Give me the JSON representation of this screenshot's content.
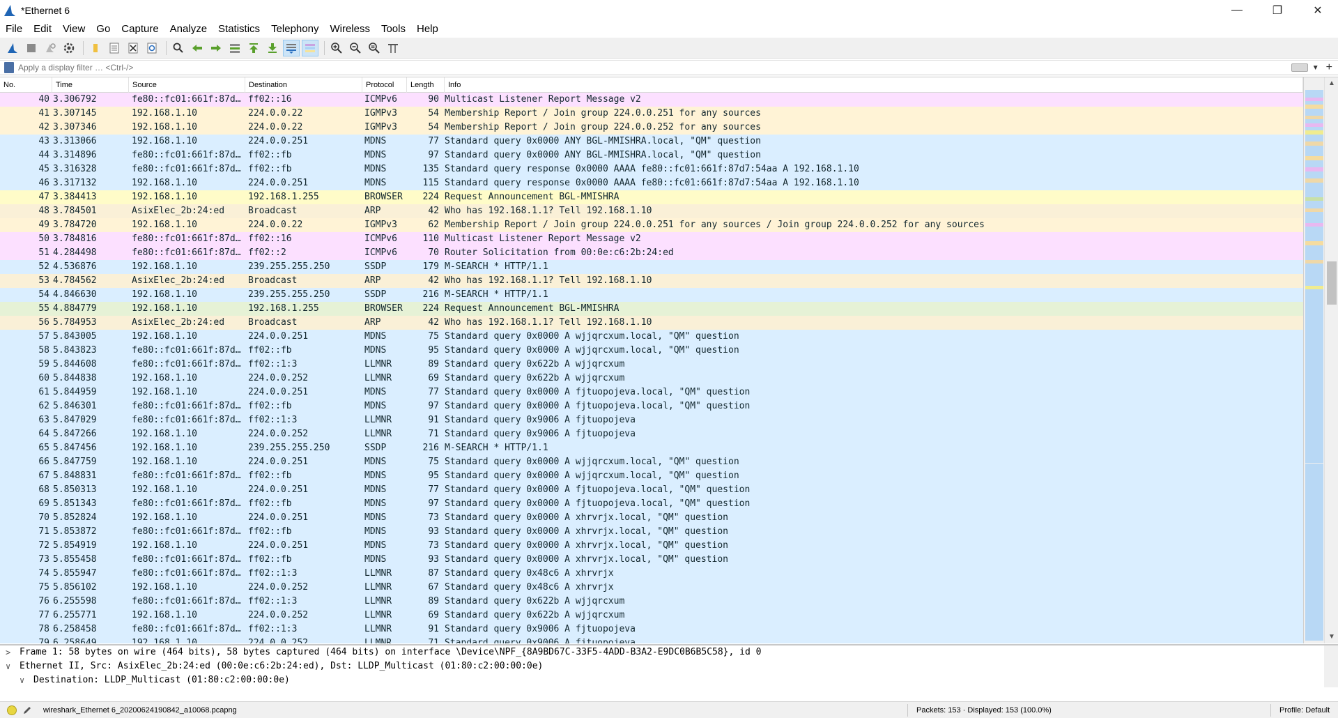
{
  "window": {
    "title": "*Ethernet 6",
    "minimize_glyph": "—",
    "maximize_glyph": "❐",
    "close_glyph": "✕"
  },
  "menu": [
    "File",
    "Edit",
    "View",
    "Go",
    "Capture",
    "Analyze",
    "Statistics",
    "Telephony",
    "Wireless",
    "Tools",
    "Help"
  ],
  "toolbar": {
    "icons": [
      "shark-fin-start-icon",
      "stop-icon",
      "restart-icon",
      "options-gear-icon",
      "open-folder-icon",
      "save-file-icon",
      "close-file-icon",
      "reload-icon",
      "find-icon",
      "go-back-icon",
      "go-forward-icon",
      "go-to-packet-icon",
      "first-packet-icon",
      "last-packet-icon",
      "autoscroll-icon",
      "colorize-icon",
      "zoom-in-icon",
      "zoom-out-icon",
      "normal-size-icon",
      "resize-columns-icon"
    ]
  },
  "filter": {
    "placeholder": "Apply a display filter … <Ctrl-/>"
  },
  "columns": [
    "No.",
    "Time",
    "Source",
    "Destination",
    "Protocol",
    "Length",
    "Info"
  ],
  "packets": [
    {
      "no": "40",
      "time": "3.306792",
      "src": "fe80::fc01:661f:87d…",
      "dst": "ff02::16",
      "proto": "ICMPv6",
      "len": "90",
      "info": "Multicast Listener Report Message v2",
      "cls": "icmp"
    },
    {
      "no": "41",
      "time": "3.307145",
      "src": "192.168.1.10",
      "dst": "224.0.0.22",
      "proto": "IGMPv3",
      "len": "54",
      "info": "Membership Report / Join group 224.0.0.251 for any sources",
      "cls": "igmp"
    },
    {
      "no": "42",
      "time": "3.307346",
      "src": "192.168.1.10",
      "dst": "224.0.0.22",
      "proto": "IGMPv3",
      "len": "54",
      "info": "Membership Report / Join group 224.0.0.252 for any sources",
      "cls": "igmp"
    },
    {
      "no": "43",
      "time": "3.313066",
      "src": "192.168.1.10",
      "dst": "224.0.0.251",
      "proto": "MDNS",
      "len": "77",
      "info": "Standard query 0x0000 ANY BGL-MMISHRA.local, \"QM\" question",
      "cls": "udp"
    },
    {
      "no": "44",
      "time": "3.314896",
      "src": "fe80::fc01:661f:87d…",
      "dst": "ff02::fb",
      "proto": "MDNS",
      "len": "97",
      "info": "Standard query 0x0000 ANY BGL-MMISHRA.local, \"QM\" question",
      "cls": "udp"
    },
    {
      "no": "45",
      "time": "3.316328",
      "src": "fe80::fc01:661f:87d…",
      "dst": "ff02::fb",
      "proto": "MDNS",
      "len": "135",
      "info": "Standard query response 0x0000 AAAA fe80::fc01:661f:87d7:54aa A 192.168.1.10",
      "cls": "udp"
    },
    {
      "no": "46",
      "time": "3.317132",
      "src": "192.168.1.10",
      "dst": "224.0.0.251",
      "proto": "MDNS",
      "len": "115",
      "info": "Standard query response 0x0000 AAAA fe80::fc01:661f:87d7:54aa A 192.168.1.10",
      "cls": "udp"
    },
    {
      "no": "47",
      "time": "3.384413",
      "src": "192.168.1.10",
      "dst": "192.168.1.255",
      "proto": "BROWSER",
      "len": "224",
      "info": "Request Announcement BGL-MMISHRA",
      "cls": "browser"
    },
    {
      "no": "48",
      "time": "3.784501",
      "src": "AsixElec_2b:24:ed",
      "dst": "Broadcast",
      "proto": "ARP",
      "len": "42",
      "info": "Who has 192.168.1.1? Tell 192.168.1.10",
      "cls": "arp"
    },
    {
      "no": "49",
      "time": "3.784720",
      "src": "192.168.1.10",
      "dst": "224.0.0.22",
      "proto": "IGMPv3",
      "len": "62",
      "info": "Membership Report / Join group 224.0.0.251 for any sources / Join group 224.0.0.252 for any sources",
      "cls": "igmp"
    },
    {
      "no": "50",
      "time": "3.784816",
      "src": "fe80::fc01:661f:87d…",
      "dst": "ff02::16",
      "proto": "ICMPv6",
      "len": "110",
      "info": "Multicast Listener Report Message v2",
      "cls": "icmp"
    },
    {
      "no": "51",
      "time": "4.284498",
      "src": "fe80::fc01:661f:87d…",
      "dst": "ff02::2",
      "proto": "ICMPv6",
      "len": "70",
      "info": "Router Solicitation from 00:0e:c6:2b:24:ed",
      "cls": "icmp"
    },
    {
      "no": "52",
      "time": "4.536876",
      "src": "192.168.1.10",
      "dst": "239.255.255.250",
      "proto": "SSDP",
      "len": "179",
      "info": "M-SEARCH * HTTP/1.1",
      "cls": "udp"
    },
    {
      "no": "53",
      "time": "4.784562",
      "src": "AsixElec_2b:24:ed",
      "dst": "Broadcast",
      "proto": "ARP",
      "len": "42",
      "info": "Who has 192.168.1.1? Tell 192.168.1.10",
      "cls": "arp"
    },
    {
      "no": "54",
      "time": "4.846630",
      "src": "192.168.1.10",
      "dst": "239.255.255.250",
      "proto": "SSDP",
      "len": "216",
      "info": "M-SEARCH * HTTP/1.1",
      "cls": "udp"
    },
    {
      "no": "55",
      "time": "4.884779",
      "src": "192.168.1.10",
      "dst": "192.168.1.255",
      "proto": "BROWSER",
      "len": "224",
      "info": "Request Announcement BGL-MMISHRA",
      "cls": "browser2"
    },
    {
      "no": "56",
      "time": "5.784953",
      "src": "AsixElec_2b:24:ed",
      "dst": "Broadcast",
      "proto": "ARP",
      "len": "42",
      "info": "Who has 192.168.1.1? Tell 192.168.1.10",
      "cls": "arp"
    },
    {
      "no": "57",
      "time": "5.843005",
      "src": "192.168.1.10",
      "dst": "224.0.0.251",
      "proto": "MDNS",
      "len": "75",
      "info": "Standard query 0x0000 A wjjqrcxum.local, \"QM\" question",
      "cls": "udp"
    },
    {
      "no": "58",
      "time": "5.843823",
      "src": "fe80::fc01:661f:87d…",
      "dst": "ff02::fb",
      "proto": "MDNS",
      "len": "95",
      "info": "Standard query 0x0000 A wjjqrcxum.local, \"QM\" question",
      "cls": "udp"
    },
    {
      "no": "59",
      "time": "5.844608",
      "src": "fe80::fc01:661f:87d…",
      "dst": "ff02::1:3",
      "proto": "LLMNR",
      "len": "89",
      "info": "Standard query 0x622b A wjjqrcxum",
      "cls": "udp"
    },
    {
      "no": "60",
      "time": "5.844838",
      "src": "192.168.1.10",
      "dst": "224.0.0.252",
      "proto": "LLMNR",
      "len": "69",
      "info": "Standard query 0x622b A wjjqrcxum",
      "cls": "udp"
    },
    {
      "no": "61",
      "time": "5.844959",
      "src": "192.168.1.10",
      "dst": "224.0.0.251",
      "proto": "MDNS",
      "len": "77",
      "info": "Standard query 0x0000 A fjtuopojeva.local, \"QM\" question",
      "cls": "udp"
    },
    {
      "no": "62",
      "time": "5.846301",
      "src": "fe80::fc01:661f:87d…",
      "dst": "ff02::fb",
      "proto": "MDNS",
      "len": "97",
      "info": "Standard query 0x0000 A fjtuopojeva.local, \"QM\" question",
      "cls": "udp"
    },
    {
      "no": "63",
      "time": "5.847029",
      "src": "fe80::fc01:661f:87d…",
      "dst": "ff02::1:3",
      "proto": "LLMNR",
      "len": "91",
      "info": "Standard query 0x9006 A fjtuopojeva",
      "cls": "udp"
    },
    {
      "no": "64",
      "time": "5.847266",
      "src": "192.168.1.10",
      "dst": "224.0.0.252",
      "proto": "LLMNR",
      "len": "71",
      "info": "Standard query 0x9006 A fjtuopojeva",
      "cls": "udp"
    },
    {
      "no": "65",
      "time": "5.847456",
      "src": "192.168.1.10",
      "dst": "239.255.255.250",
      "proto": "SSDP",
      "len": "216",
      "info": "M-SEARCH * HTTP/1.1",
      "cls": "udp"
    },
    {
      "no": "66",
      "time": "5.847759",
      "src": "192.168.1.10",
      "dst": "224.0.0.251",
      "proto": "MDNS",
      "len": "75",
      "info": "Standard query 0x0000 A wjjqrcxum.local, \"QM\" question",
      "cls": "udp"
    },
    {
      "no": "67",
      "time": "5.848831",
      "src": "fe80::fc01:661f:87d…",
      "dst": "ff02::fb",
      "proto": "MDNS",
      "len": "95",
      "info": "Standard query 0x0000 A wjjqrcxum.local, \"QM\" question",
      "cls": "udp"
    },
    {
      "no": "68",
      "time": "5.850313",
      "src": "192.168.1.10",
      "dst": "224.0.0.251",
      "proto": "MDNS",
      "len": "77",
      "info": "Standard query 0x0000 A fjtuopojeva.local, \"QM\" question",
      "cls": "udp"
    },
    {
      "no": "69",
      "time": "5.851343",
      "src": "fe80::fc01:661f:87d…",
      "dst": "ff02::fb",
      "proto": "MDNS",
      "len": "97",
      "info": "Standard query 0x0000 A fjtuopojeva.local, \"QM\" question",
      "cls": "udp"
    },
    {
      "no": "70",
      "time": "5.852824",
      "src": "192.168.1.10",
      "dst": "224.0.0.251",
      "proto": "MDNS",
      "len": "73",
      "info": "Standard query 0x0000 A xhrvrjx.local, \"QM\" question",
      "cls": "udp"
    },
    {
      "no": "71",
      "time": "5.853872",
      "src": "fe80::fc01:661f:87d…",
      "dst": "ff02::fb",
      "proto": "MDNS",
      "len": "93",
      "info": "Standard query 0x0000 A xhrvrjx.local, \"QM\" question",
      "cls": "udp"
    },
    {
      "no": "72",
      "time": "5.854919",
      "src": "192.168.1.10",
      "dst": "224.0.0.251",
      "proto": "MDNS",
      "len": "73",
      "info": "Standard query 0x0000 A xhrvrjx.local, \"QM\" question",
      "cls": "udp"
    },
    {
      "no": "73",
      "time": "5.855458",
      "src": "fe80::fc01:661f:87d…",
      "dst": "ff02::fb",
      "proto": "MDNS",
      "len": "93",
      "info": "Standard query 0x0000 A xhrvrjx.local, \"QM\" question",
      "cls": "udp"
    },
    {
      "no": "74",
      "time": "5.855947",
      "src": "fe80::fc01:661f:87d…",
      "dst": "ff02::1:3",
      "proto": "LLMNR",
      "len": "87",
      "info": "Standard query 0x48c6 A xhrvrjx",
      "cls": "udp"
    },
    {
      "no": "75",
      "time": "5.856102",
      "src": "192.168.1.10",
      "dst": "224.0.0.252",
      "proto": "LLMNR",
      "len": "67",
      "info": "Standard query 0x48c6 A xhrvrjx",
      "cls": "udp"
    },
    {
      "no": "76",
      "time": "6.255598",
      "src": "fe80::fc01:661f:87d…",
      "dst": "ff02::1:3",
      "proto": "LLMNR",
      "len": "89",
      "info": "Standard query 0x622b A wjjqrcxum",
      "cls": "udp"
    },
    {
      "no": "77",
      "time": "6.255771",
      "src": "192.168.1.10",
      "dst": "224.0.0.252",
      "proto": "LLMNR",
      "len": "69",
      "info": "Standard query 0x622b A wjjqrcxum",
      "cls": "udp"
    },
    {
      "no": "78",
      "time": "6.258458",
      "src": "fe80::fc01:661f:87d…",
      "dst": "ff02::1:3",
      "proto": "LLMNR",
      "len": "91",
      "info": "Standard query 0x9006 A fjtuopojeva",
      "cls": "udp"
    },
    {
      "no": "79",
      "time": "6.258649",
      "src": "192.168.1.10",
      "dst": "224.0.0.252",
      "proto": "LLMNR",
      "len": "71",
      "info": "Standard query 0x9006 A fjtuopojeva",
      "cls": "udp"
    }
  ],
  "details": [
    {
      "arrow": ">",
      "text": "Frame 1: 58 bytes on wire (464 bits), 58 bytes captured (464 bits) on interface \\Device\\NPF_{8A9BD67C-33F5-4ADD-B3A2-E9DC0B6B5C58}, id 0",
      "sub": false
    },
    {
      "arrow": "∨",
      "text": "Ethernet II, Src: AsixElec_2b:24:ed (00:0e:c6:2b:24:ed), Dst: LLDP_Multicast (01:80:c2:00:00:0e)",
      "sub": false
    },
    {
      "arrow": "∨",
      "text": "Destination: LLDP_Multicast (01:80:c2:00:00:0e)",
      "sub": true
    }
  ],
  "status": {
    "file": "wireshark_Ethernet 6_20200624190842_a10068.pcapng",
    "packets": "Packets: 153 · Displayed: 153 (100.0%)",
    "profile": "Profile: Default"
  },
  "colors": {
    "icmp": "#fce0ff",
    "igmp": "#fff3d6",
    "udp": "#daeeff",
    "browser": "#fffcc8",
    "arp": "#faf0d7"
  }
}
